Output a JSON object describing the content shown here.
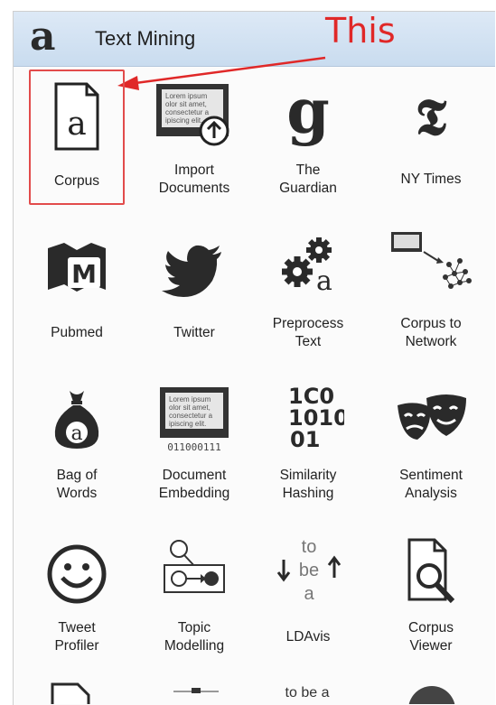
{
  "header": {
    "logo_glyph": "a",
    "title": "Text Mining"
  },
  "annotation": {
    "text": "This",
    "color": "#e02828"
  },
  "widgets": [
    {
      "label": [
        "Corpus"
      ],
      "icon": "corpus-icon"
    },
    {
      "label": [
        "Import",
        "Documents"
      ],
      "icon": "import-documents-icon"
    },
    {
      "label": [
        "The",
        "Guardian"
      ],
      "icon": "guardian-icon"
    },
    {
      "label": [
        "NY Times"
      ],
      "icon": "ny-times-icon"
    },
    {
      "label": [
        "Pubmed"
      ],
      "icon": "pubmed-icon"
    },
    {
      "label": [
        "Twitter"
      ],
      "icon": "twitter-icon"
    },
    {
      "label": [
        "Preprocess",
        "Text"
      ],
      "icon": "preprocess-icon"
    },
    {
      "label": [
        "Corpus to",
        "Network"
      ],
      "icon": "corpus-network-icon"
    },
    {
      "label": [
        "Bag of",
        "Words"
      ],
      "icon": "bag-of-words-icon"
    },
    {
      "label": [
        "Document",
        "Embedding"
      ],
      "icon": "document-embedding-icon"
    },
    {
      "label": [
        "Similarity",
        "Hashing"
      ],
      "icon": "similarity-hashing-icon"
    },
    {
      "label": [
        "Sentiment",
        "Analysis"
      ],
      "icon": "sentiment-analysis-icon"
    },
    {
      "label": [
        "Tweet",
        "Profiler"
      ],
      "icon": "tweet-profiler-icon"
    },
    {
      "label": [
        "Topic",
        "Modelling"
      ],
      "icon": "topic-modelling-icon"
    },
    {
      "label": [
        "LDAvis"
      ],
      "icon": "ldavis-icon"
    },
    {
      "label": [
        "Corpus",
        "Viewer"
      ],
      "icon": "corpus-viewer-icon"
    }
  ],
  "icon_text": {
    "corpus_letter": "a",
    "lorem": [
      "Lorem ipsum",
      "olor sit amet,",
      "consectetur a",
      "ipiscing elit."
    ],
    "guardian": "g",
    "nytimes": "𝕿",
    "pubmed": "M",
    "bag_letter": "a",
    "binary_caption": "011000111",
    "hash_lines": [
      "1C0",
      "1010",
      "01"
    ],
    "lda": [
      "to",
      "be",
      "a"
    ],
    "partial_text": "to be a"
  }
}
